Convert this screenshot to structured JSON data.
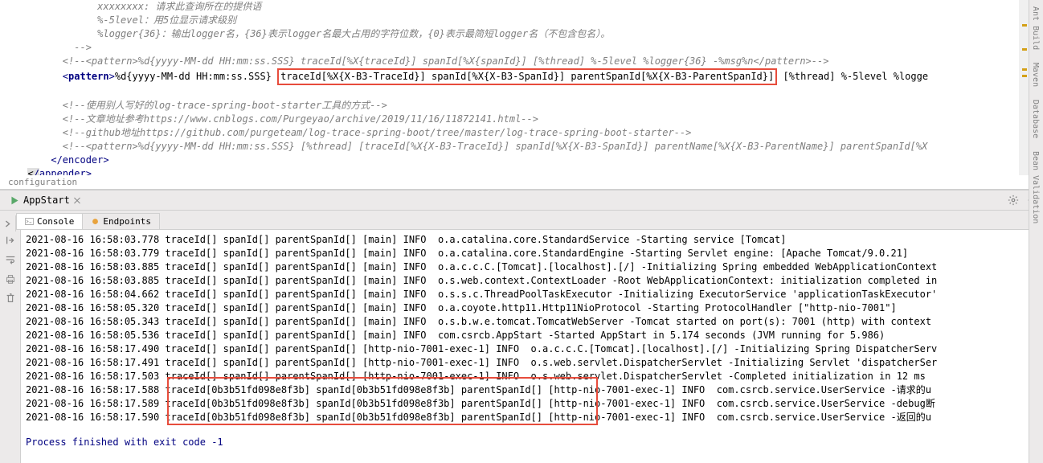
{
  "editor": {
    "lines": [
      {
        "indent": 14,
        "text": "",
        "comment": "xxxxxxxx: 请求此查询所在的提供语"
      },
      {
        "indent": 14,
        "text": "",
        "comment": "%-5level：用5位显示请求级别"
      },
      {
        "indent": 14,
        "text": "",
        "comment": "%logger{36}：输出logger名，{36}表示logger名最大占用的字符位数，{0}表示最简短logger名（不包含包名）。"
      },
      {
        "indent": 10,
        "text": "",
        "comment": "-->"
      },
      {
        "indent": 8,
        "text": "",
        "comment": "<!--<pattern>%d{yyyy-MM-dd HH:mm:ss.SSS} traceId[%X{traceId}] spanId[%X{spanId}] [%thread] %-5level %logger{36} -%msg%n</pattern>-->"
      },
      {
        "indent": 8,
        "type": "pattern",
        "open": "<pattern>",
        "before_box": "%d{yyyy-MM-dd HH:mm:ss.SSS} ",
        "boxed": "traceId[%X{X-B3-TraceId}] spanId[%X{X-B3-SpanId}] parentSpanId[%X{X-B3-ParentSpanId}]",
        "after_box": " [%thread] %-5level %logge"
      },
      {
        "indent": 0,
        "text": "",
        "blank": true
      },
      {
        "indent": 8,
        "text": "",
        "comment": "<!--使用别人写好的log-trace-spring-boot-starter工具的方式-->"
      },
      {
        "indent": 8,
        "text": "",
        "comment": "<!--文章地址参考https://www.cnblogs.com/Purgeyao/archive/2019/11/16/11872141.html-->"
      },
      {
        "indent": 8,
        "text": "",
        "comment": "<!--github地址https://github.com/purgeteam/log-trace-spring-boot/tree/master/log-trace-spring-boot-starter-->"
      },
      {
        "indent": 8,
        "text": "",
        "comment": "<!--<pattern>%d{yyyy-MM-dd HH:mm:ss.SSS} [%thread] [traceId[%X{X-B3-TraceId}] spanId[%X{X-B3-SpanId}] parentName[%X{X-B3-ParentName}] parentSpanId[%X"
      },
      {
        "indent": 6,
        "type": "close",
        "tag": "</encoder>"
      },
      {
        "indent": 2,
        "type": "close-split",
        "before": "</",
        "name": "appender",
        "after": ">"
      }
    ]
  },
  "breadcrumb": "configuration",
  "run_tab": {
    "label": "AppStart"
  },
  "sub_tabs": {
    "console": "Console",
    "endpoints": "Endpoints"
  },
  "console": {
    "lines": [
      "2021-08-16 16:58:03.778 traceId[] spanId[] parentSpanId[] [main] INFO  o.a.catalina.core.StandardService -Starting service [Tomcat]",
      "2021-08-16 16:58:03.779 traceId[] spanId[] parentSpanId[] [main] INFO  o.a.catalina.core.StandardEngine -Starting Servlet engine: [Apache Tomcat/9.0.21]",
      "2021-08-16 16:58:03.885 traceId[] spanId[] parentSpanId[] [main] INFO  o.a.c.c.C.[Tomcat].[localhost].[/] -Initializing Spring embedded WebApplicationContext",
      "2021-08-16 16:58:03.885 traceId[] spanId[] parentSpanId[] [main] INFO  o.s.web.context.ContextLoader -Root WebApplicationContext: initialization completed in",
      "2021-08-16 16:58:04.662 traceId[] spanId[] parentSpanId[] [main] INFO  o.s.s.c.ThreadPoolTaskExecutor -Initializing ExecutorService 'applicationTaskExecutor'",
      "2021-08-16 16:58:05.320 traceId[] spanId[] parentSpanId[] [main] INFO  o.a.coyote.http11.Http11NioProtocol -Starting ProtocolHandler [\"http-nio-7001\"]",
      "2021-08-16 16:58:05.343 traceId[] spanId[] parentSpanId[] [main] INFO  o.s.b.w.e.tomcat.TomcatWebServer -Tomcat started on port(s): 7001 (http) with context",
      "2021-08-16 16:58:05.536 traceId[] spanId[] parentSpanId[] [main] INFO  com.csrcb.AppStart -Started AppStart in 5.174 seconds (JVM running for 5.986)",
      "2021-08-16 16:58:17.490 traceId[] spanId[] parentSpanId[] [http-nio-7001-exec-1] INFO  o.a.c.c.C.[Tomcat].[localhost].[/] -Initializing Spring DispatcherServ",
      "2021-08-16 16:58:17.491 traceId[] spanId[] parentSpanId[] [http-nio-7001-exec-1] INFO  o.s.web.servlet.DispatcherServlet -Initializing Servlet 'dispatcherSer",
      "2021-08-16 16:58:17.503 traceId[] spanId[] parentSpanId[] [http-nio-7001-exec-1] INFO  o.s.web.servlet.DispatcherServlet -Completed initialization in 12 ms",
      "2021-08-16 16:58:17.588 traceId[0b3b51fd098e8f3b] spanId[0b3b51fd098e8f3b] parentSpanId[] [http-nio-7001-exec-1] INFO  com.csrcb.service.UserService -请求的u",
      "2021-08-16 16:58:17.589 traceId[0b3b51fd098e8f3b] spanId[0b3b51fd098e8f3b] parentSpanId[] [http-nio-7001-exec-1] INFO  com.csrcb.service.UserService -debug断",
      "2021-08-16 16:58:17.590 traceId[0b3b51fd098e8f3b] spanId[0b3b51fd098e8f3b] parentSpanId[] [http-nio-7001-exec-1] INFO  com.csrcb.service.UserService -返回的u"
    ],
    "exit": "Process finished with exit code -1"
  },
  "right_tabs": {
    "ant": "Ant Build",
    "maven": "Maven",
    "database": "Database",
    "bean": "Bean Validation"
  }
}
